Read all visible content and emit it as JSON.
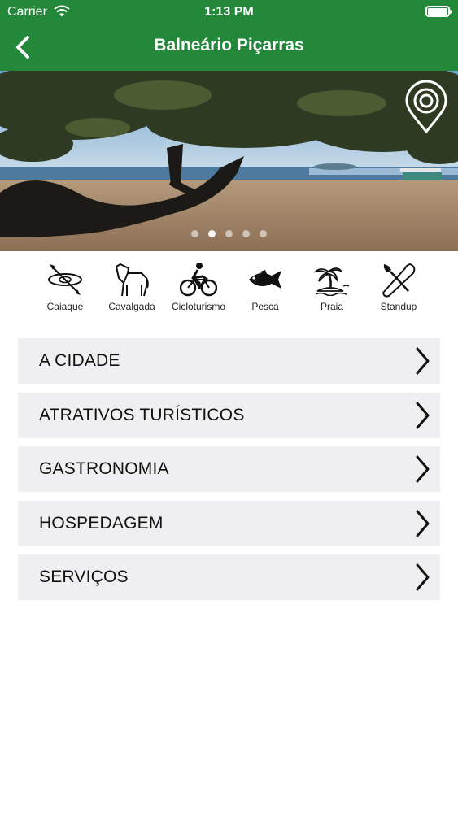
{
  "status_bar": {
    "carrier": "Carrier",
    "time": "1:13 PM"
  },
  "nav": {
    "title": "Balneário Piçarras",
    "back_icon": "chevron-left-icon"
  },
  "colors": {
    "brand_green": "#23883a",
    "menu_bg": "#efeff1"
  },
  "hero": {
    "slides": 5,
    "active_slide": 1,
    "map_icon": "map-pin-icon"
  },
  "categories": [
    {
      "label": "Caiaque",
      "icon": "kayak-icon"
    },
    {
      "label": "Cavalgada",
      "icon": "horse-icon"
    },
    {
      "label": "Cicloturismo",
      "icon": "bicycle-icon"
    },
    {
      "label": "Pesca",
      "icon": "fish-icon"
    },
    {
      "label": "Praia",
      "icon": "beach-icon"
    },
    {
      "label": "Standup",
      "icon": "standup-paddle-icon"
    }
  ],
  "menu": [
    {
      "label": "A CIDADE"
    },
    {
      "label": "ATRATIVOS TURÍSTICOS"
    },
    {
      "label": "GASTRONOMIA"
    },
    {
      "label": "HOSPEDAGEM"
    },
    {
      "label": "SERVIÇOS"
    }
  ]
}
